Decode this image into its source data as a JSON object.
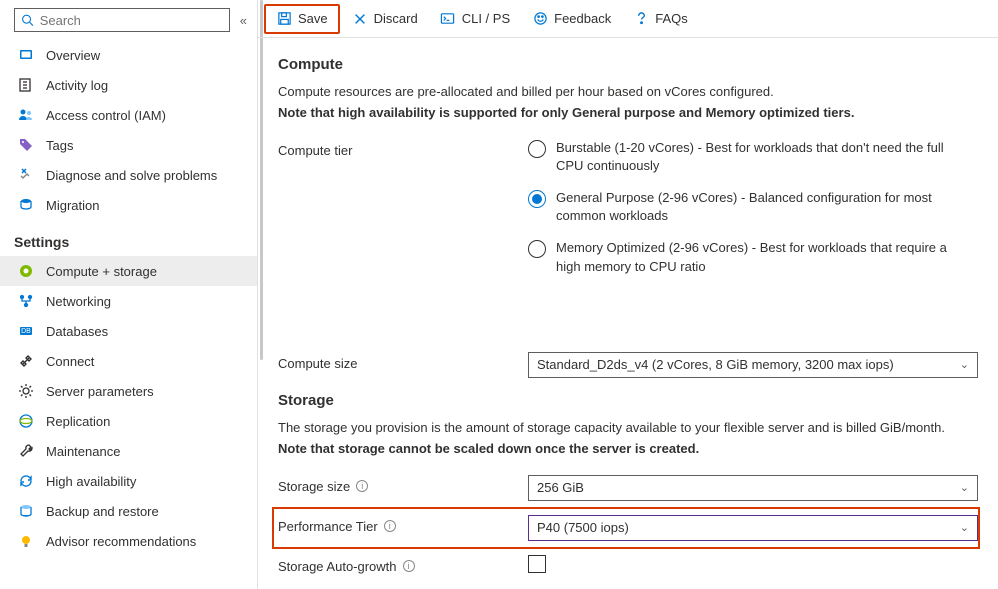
{
  "search": {
    "placeholder": "Search"
  },
  "sidebar": {
    "items": [
      {
        "label": "Overview"
      },
      {
        "label": "Activity log"
      },
      {
        "label": "Access control (IAM)"
      },
      {
        "label": "Tags"
      },
      {
        "label": "Diagnose and solve problems"
      },
      {
        "label": "Migration"
      }
    ],
    "settings_header": "Settings",
    "settings": [
      {
        "label": "Compute + storage"
      },
      {
        "label": "Networking"
      },
      {
        "label": "Databases"
      },
      {
        "label": "Connect"
      },
      {
        "label": "Server parameters"
      },
      {
        "label": "Replication"
      },
      {
        "label": "Maintenance"
      },
      {
        "label": "High availability"
      },
      {
        "label": "Backup and restore"
      },
      {
        "label": "Advisor recommendations"
      }
    ]
  },
  "toolbar": {
    "save": "Save",
    "discard": "Discard",
    "cli": "CLI / PS",
    "feedback": "Feedback",
    "faqs": "FAQs"
  },
  "compute": {
    "title": "Compute",
    "desc": "Compute resources are pre-allocated and billed per hour based on vCores configured.",
    "note": "Note that high availability is supported for only General purpose and Memory optimized tiers.",
    "tier_label": "Compute tier",
    "options": [
      "Burstable (1-20 vCores) - Best for workloads that don't need the full CPU continuously",
      "General Purpose (2-96 vCores) - Balanced configuration for most common workloads",
      "Memory Optimized (2-96 vCores) - Best for workloads that require a high memory to CPU ratio"
    ],
    "size_label": "Compute size",
    "size_value": "Standard_D2ds_v4 (2 vCores, 8 GiB memory, 3200 max iops)"
  },
  "storage": {
    "title": "Storage",
    "desc": "The storage you provision is the amount of storage capacity available to your flexible server and is billed GiB/month.",
    "note": "Note that storage cannot be scaled down once the server is created.",
    "size_label": "Storage size",
    "size_value": "256 GiB",
    "perf_label": "Performance Tier",
    "perf_value": "P40 (7500 iops)",
    "auto_label": "Storage Auto-growth"
  }
}
